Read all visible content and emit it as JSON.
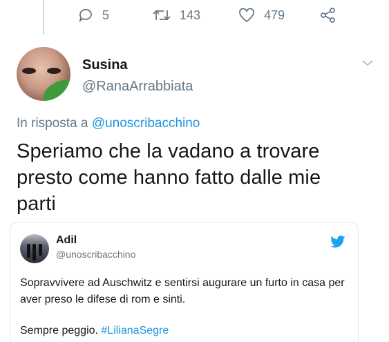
{
  "actions": {
    "reply_count": "5",
    "retweet_count": "143",
    "like_count": "479"
  },
  "tweet": {
    "display_name": "Susina",
    "handle": "@RanaArrabbiata",
    "reply_prefix": "In risposta a ",
    "reply_to": "@unoscribacchino",
    "text": "Speriamo che la vadano a trovare presto come hanno fatto dalle mie parti"
  },
  "quoted": {
    "display_name": "Adil",
    "handle": "@unoscribacchino",
    "text": "Sopravvivere ad Auschwitz e sentirsi augurare un furto in casa per aver preso le difese di rom e sinti.",
    "text2_prefix": "Sempre peggio. ",
    "hashtag": "#LilianaSegre"
  },
  "colors": {
    "accent": "#1b95e0",
    "muted": "#657786",
    "text": "#14171a",
    "border": "#e1e8ed"
  },
  "icons": {
    "reply": "reply-icon",
    "retweet": "retweet-icon",
    "like": "heart-icon",
    "share": "share-icon",
    "caret": "chevron-down-icon",
    "brand": "twitter-bird-icon"
  }
}
